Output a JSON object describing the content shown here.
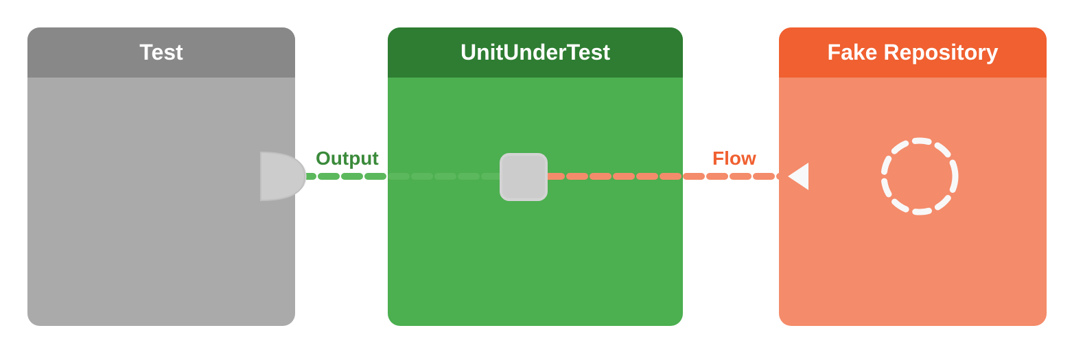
{
  "blocks": {
    "test": {
      "title": "Test",
      "header_bg": "#888888",
      "body_bg": "#aaaaaa"
    },
    "unit": {
      "title": "UnitUnderTest",
      "header_bg": "#2e7d32",
      "body_bg": "#4caf50"
    },
    "fake": {
      "title": "Fake Repository",
      "header_bg": "#f06030",
      "body_bg": "#f48b6a"
    }
  },
  "labels": {
    "output": "Output",
    "flow": "Flow"
  },
  "colors": {
    "output_color": "#3a8a3a",
    "flow_color": "#f06030",
    "connector_fill": "#cccccc",
    "connector_stroke": "#d8d8d8",
    "dashed_stroke": "#f8f8f8",
    "line_green": "#5cb85c",
    "line_orange": "#f48b6a"
  }
}
